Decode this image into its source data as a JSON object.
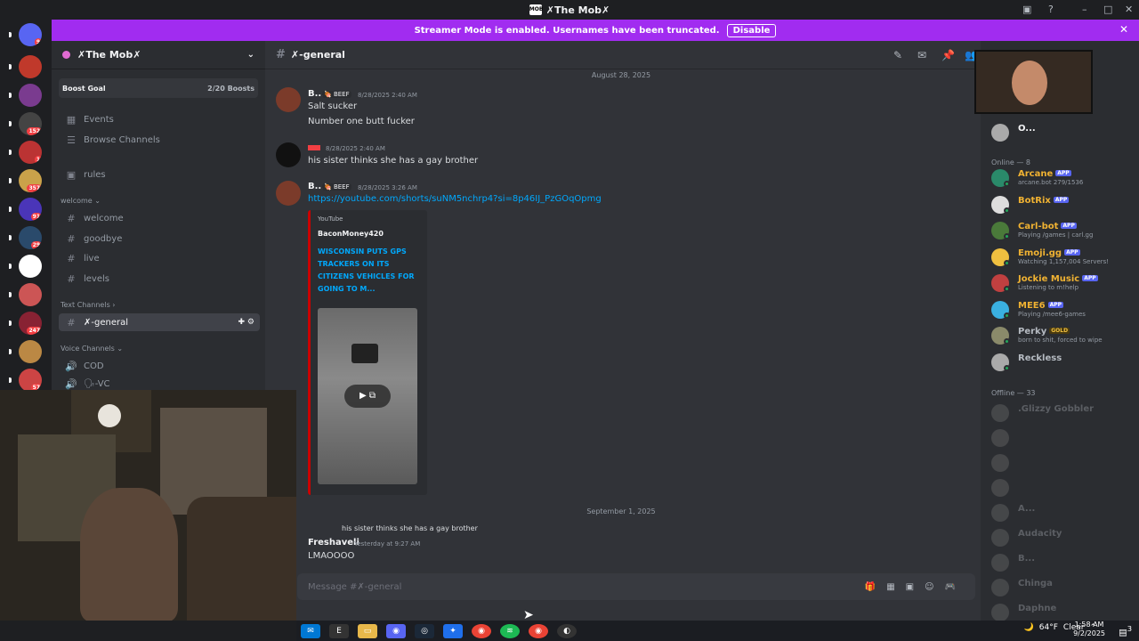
{
  "window": {
    "title": "✗The Mob✗",
    "logo": "MOB"
  },
  "banner": {
    "text": "Streamer Mode is enabled. Usernames have been truncated.",
    "disable_label": "Disable"
  },
  "servers": [
    {
      "badge": "9"
    },
    {
      "badge": ""
    },
    {
      "badge": ""
    },
    {
      "badge": "152"
    },
    {
      "badge": "1"
    },
    {
      "badge": "357"
    },
    {
      "badge": "91"
    },
    {
      "badge": "29"
    },
    {
      "badge": ""
    },
    {
      "badge": ""
    },
    {
      "badge": "247"
    },
    {
      "badge": ""
    },
    {
      "badge": "57"
    }
  ],
  "sidebar": {
    "server_name": "✗The Mob✗",
    "boost_goal": "Boost Goal",
    "boost_count": "2/20 Boosts",
    "items": [
      {
        "icon": "calendar-icon",
        "label": "Events"
      },
      {
        "icon": "browse-icon",
        "label": "Browse Channels"
      },
      {
        "icon": "rules-icon",
        "label": "rules"
      }
    ],
    "categories": {
      "welcome": "welcome",
      "text": "Text Channels",
      "voice": "Voice Channels"
    },
    "welcome_channels": [
      "welcome",
      "goodbye",
      "live",
      "levels"
    ],
    "text_channels": [
      "✗-general"
    ],
    "voice_channels": [
      "COD",
      "🗣-VC"
    ]
  },
  "chat": {
    "channel": "✗-general",
    "date1": "August 28, 2025",
    "date2": "September 1, 2025",
    "messages": [
      {
        "author": "B...",
        "tag": "🍖 BEEF",
        "time": "8/28/2025 2:40 AM",
        "lines": [
          "Salt sucker",
          "Number one butt fucker"
        ]
      },
      {
        "author": "",
        "tag": "",
        "time": "8/28/2025 2:40 AM",
        "lines": [
          "his sister thinks she has a gay brother"
        ]
      },
      {
        "author": "B...",
        "tag": "🍖 BEEF",
        "time": "8/28/2025 3:26 AM",
        "lines": [
          "https://youtube.com/shorts/suNM5nchrp4?si=8p46IJ_PzGOqOpmg"
        ]
      }
    ],
    "embed": {
      "provider": "YouTube",
      "author": "BaconMoney420",
      "title": "WISCONSIN PUTS GPS TRACKERS ON ITS CITIZENS VEHICLES FOR GOING TO M..."
    },
    "reply": {
      "quoted": "his sister thinks she has a gay brother",
      "author": "Freshaveli",
      "time": "Yesterday at 9:27 AM",
      "text": "LMAOOOO"
    },
    "input_placeholder": "Message #✗-general"
  },
  "members": {
    "top": "O...",
    "online_header": "Online — 8",
    "offline_header": "Offline — 33",
    "online": [
      {
        "name": "Arcane",
        "app": "APP",
        "sub": "arcane.bot 279/1536",
        "color": "#f0b232"
      },
      {
        "name": "BotRix",
        "app": "APP",
        "sub": "",
        "color": "#f0b232"
      },
      {
        "name": "Carl-bot",
        "app": "APP",
        "sub": "Playing /games | carl.gg",
        "color": "#f0b232"
      },
      {
        "name": "Emoji.gg",
        "app": "APP",
        "sub": "Watching 1,157,004 Servers!",
        "color": "#f0b232"
      },
      {
        "name": "Jockie Music",
        "app": "APP",
        "sub": "Listening to m!help",
        "color": "#f0b232"
      },
      {
        "name": "MEE6",
        "app": "APP",
        "sub": "Playing /mee6-games",
        "color": "#f0b232"
      },
      {
        "name": "Perky",
        "app": "GOLD",
        "sub": "born to shit, forced to wipe",
        "color": "#b5bac1"
      },
      {
        "name": "Reckless",
        "app": "",
        "sub": "",
        "color": "#b5bac1"
      }
    ],
    "offline": [
      ".Glizzy Gobbler",
      "",
      "",
      "",
      "A...",
      "Audacity",
      "B...",
      "Chinga",
      "Daphne"
    ]
  },
  "taskbar": {
    "weather": "64°F",
    "condition": "Clear",
    "time": "1:58 AM",
    "date": "9/2/2025",
    "notif": "3"
  }
}
